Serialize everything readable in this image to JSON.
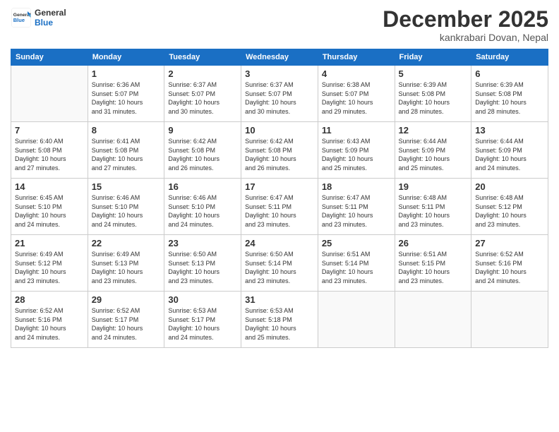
{
  "logo": {
    "line1": "General",
    "line2": "Blue"
  },
  "title": "December 2025",
  "location": "kankrabari Dovan, Nepal",
  "weekdays": [
    "Sunday",
    "Monday",
    "Tuesday",
    "Wednesday",
    "Thursday",
    "Friday",
    "Saturday"
  ],
  "weeks": [
    [
      {
        "day": "",
        "info": ""
      },
      {
        "day": "1",
        "info": "Sunrise: 6:36 AM\nSunset: 5:07 PM\nDaylight: 10 hours\nand 31 minutes."
      },
      {
        "day": "2",
        "info": "Sunrise: 6:37 AM\nSunset: 5:07 PM\nDaylight: 10 hours\nand 30 minutes."
      },
      {
        "day": "3",
        "info": "Sunrise: 6:37 AM\nSunset: 5:07 PM\nDaylight: 10 hours\nand 30 minutes."
      },
      {
        "day": "4",
        "info": "Sunrise: 6:38 AM\nSunset: 5:07 PM\nDaylight: 10 hours\nand 29 minutes."
      },
      {
        "day": "5",
        "info": "Sunrise: 6:39 AM\nSunset: 5:08 PM\nDaylight: 10 hours\nand 28 minutes."
      },
      {
        "day": "6",
        "info": "Sunrise: 6:39 AM\nSunset: 5:08 PM\nDaylight: 10 hours\nand 28 minutes."
      }
    ],
    [
      {
        "day": "7",
        "info": "Sunrise: 6:40 AM\nSunset: 5:08 PM\nDaylight: 10 hours\nand 27 minutes."
      },
      {
        "day": "8",
        "info": "Sunrise: 6:41 AM\nSunset: 5:08 PM\nDaylight: 10 hours\nand 27 minutes."
      },
      {
        "day": "9",
        "info": "Sunrise: 6:42 AM\nSunset: 5:08 PM\nDaylight: 10 hours\nand 26 minutes."
      },
      {
        "day": "10",
        "info": "Sunrise: 6:42 AM\nSunset: 5:08 PM\nDaylight: 10 hours\nand 26 minutes."
      },
      {
        "day": "11",
        "info": "Sunrise: 6:43 AM\nSunset: 5:09 PM\nDaylight: 10 hours\nand 25 minutes."
      },
      {
        "day": "12",
        "info": "Sunrise: 6:44 AM\nSunset: 5:09 PM\nDaylight: 10 hours\nand 25 minutes."
      },
      {
        "day": "13",
        "info": "Sunrise: 6:44 AM\nSunset: 5:09 PM\nDaylight: 10 hours\nand 24 minutes."
      }
    ],
    [
      {
        "day": "14",
        "info": "Sunrise: 6:45 AM\nSunset: 5:10 PM\nDaylight: 10 hours\nand 24 minutes."
      },
      {
        "day": "15",
        "info": "Sunrise: 6:46 AM\nSunset: 5:10 PM\nDaylight: 10 hours\nand 24 minutes."
      },
      {
        "day": "16",
        "info": "Sunrise: 6:46 AM\nSunset: 5:10 PM\nDaylight: 10 hours\nand 24 minutes."
      },
      {
        "day": "17",
        "info": "Sunrise: 6:47 AM\nSunset: 5:11 PM\nDaylight: 10 hours\nand 23 minutes."
      },
      {
        "day": "18",
        "info": "Sunrise: 6:47 AM\nSunset: 5:11 PM\nDaylight: 10 hours\nand 23 minutes."
      },
      {
        "day": "19",
        "info": "Sunrise: 6:48 AM\nSunset: 5:11 PM\nDaylight: 10 hours\nand 23 minutes."
      },
      {
        "day": "20",
        "info": "Sunrise: 6:48 AM\nSunset: 5:12 PM\nDaylight: 10 hours\nand 23 minutes."
      }
    ],
    [
      {
        "day": "21",
        "info": "Sunrise: 6:49 AM\nSunset: 5:12 PM\nDaylight: 10 hours\nand 23 minutes."
      },
      {
        "day": "22",
        "info": "Sunrise: 6:49 AM\nSunset: 5:13 PM\nDaylight: 10 hours\nand 23 minutes."
      },
      {
        "day": "23",
        "info": "Sunrise: 6:50 AM\nSunset: 5:13 PM\nDaylight: 10 hours\nand 23 minutes."
      },
      {
        "day": "24",
        "info": "Sunrise: 6:50 AM\nSunset: 5:14 PM\nDaylight: 10 hours\nand 23 minutes."
      },
      {
        "day": "25",
        "info": "Sunrise: 6:51 AM\nSunset: 5:14 PM\nDaylight: 10 hours\nand 23 minutes."
      },
      {
        "day": "26",
        "info": "Sunrise: 6:51 AM\nSunset: 5:15 PM\nDaylight: 10 hours\nand 23 minutes."
      },
      {
        "day": "27",
        "info": "Sunrise: 6:52 AM\nSunset: 5:16 PM\nDaylight: 10 hours\nand 24 minutes."
      }
    ],
    [
      {
        "day": "28",
        "info": "Sunrise: 6:52 AM\nSunset: 5:16 PM\nDaylight: 10 hours\nand 24 minutes."
      },
      {
        "day": "29",
        "info": "Sunrise: 6:52 AM\nSunset: 5:17 PM\nDaylight: 10 hours\nand 24 minutes."
      },
      {
        "day": "30",
        "info": "Sunrise: 6:53 AM\nSunset: 5:17 PM\nDaylight: 10 hours\nand 24 minutes."
      },
      {
        "day": "31",
        "info": "Sunrise: 6:53 AM\nSunset: 5:18 PM\nDaylight: 10 hours\nand 25 minutes."
      },
      {
        "day": "",
        "info": ""
      },
      {
        "day": "",
        "info": ""
      },
      {
        "day": "",
        "info": ""
      }
    ]
  ]
}
